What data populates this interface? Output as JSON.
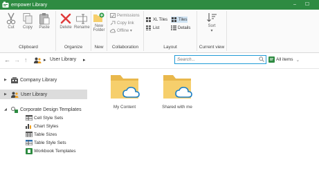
{
  "window": {
    "title": "empower Library",
    "minimize_glyph": "–",
    "maximize_glyph": "☐"
  },
  "ribbon": {
    "clipboard": {
      "label": "Clipboard",
      "cut": "Cut",
      "copy": "Copy",
      "paste": "Paste"
    },
    "organize": {
      "label": "Organize",
      "delete": "Delete",
      "rename": "Rename"
    },
    "new": {
      "label": "New",
      "new_folder_line1": "New",
      "new_folder_line2": "Folder"
    },
    "collaboration": {
      "label": "Collaboration",
      "permissions": "Permissions",
      "copy_link": "Copy link",
      "offline": "Offline ▾"
    },
    "layout": {
      "label": "Layout",
      "xl_tiles": "XL Tiles",
      "tiles": "Tiles",
      "list": "List",
      "details": "Details"
    },
    "current_view": {
      "label": "Current view",
      "sort": "Sort",
      "sort_caret": "▾"
    }
  },
  "addressbar": {
    "back": "←",
    "forward": "→",
    "up": "↑",
    "crumb_sep": "▸",
    "location": "User Library",
    "location_caret": "▸",
    "search_placeholder": "Search...",
    "filter_label": "All items",
    "filter_caret": "⌄"
  },
  "sidebar": {
    "items": [
      {
        "label": "Company Library",
        "expander": "▶"
      },
      {
        "label": "User Library",
        "expander": "▶"
      },
      {
        "label": "Corporate Design Templates",
        "expander": "◢"
      }
    ],
    "sub_items": [
      {
        "label": "Cell Style Sets"
      },
      {
        "label": "Chart Styles"
      },
      {
        "label": "Table Sizes"
      },
      {
        "label": "Table Style Sets"
      },
      {
        "label": "Workbook Templates"
      }
    ]
  },
  "content": {
    "folders": [
      {
        "label": "My Content"
      },
      {
        "label": "Shared with me"
      }
    ]
  },
  "colors": {
    "titlebar": "#2e8b42",
    "accent_blue": "#1e9ad6",
    "folder_yellow": "#f6cf6c",
    "selected_gray": "#dcdcdc"
  }
}
